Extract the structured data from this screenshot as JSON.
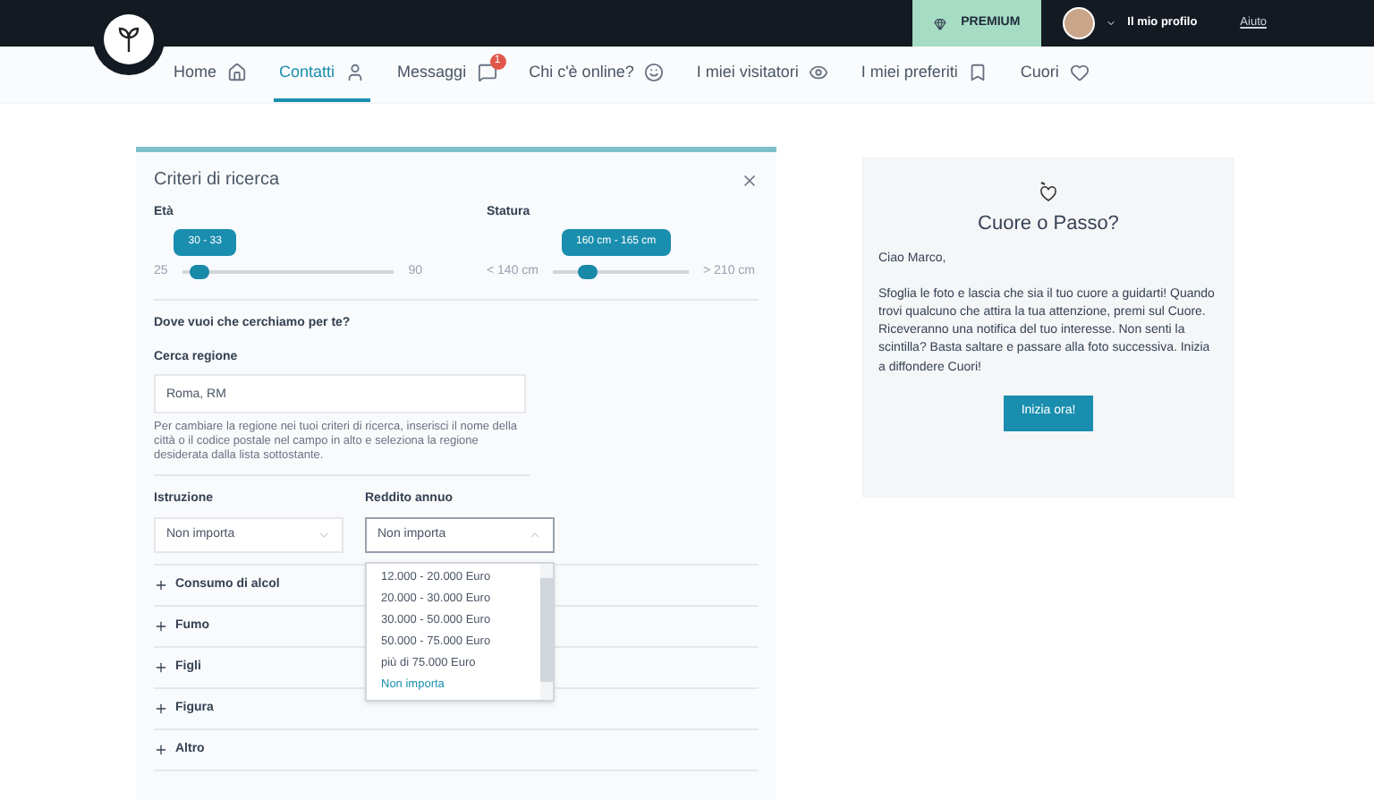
{
  "top_bar": {
    "premium": "PREMIUM",
    "profile": "Il mio profilo",
    "help": "Aiuto"
  },
  "nav": [
    {
      "label": "Home",
      "selected": false
    },
    {
      "label": "Contatti",
      "selected": true
    },
    {
      "label": "Messaggi",
      "selected": false,
      "badge": "1"
    },
    {
      "label": "Chi c'è online?",
      "selected": false
    },
    {
      "label": "I miei visitatori",
      "selected": false
    },
    {
      "label": "I miei preferiti",
      "selected": false
    },
    {
      "label": "Cuori",
      "selected": false
    }
  ],
  "search_panel": {
    "title": "Criteri di ricerca",
    "sliders": [
      {
        "label": "Età",
        "min": "25",
        "max": "90",
        "value": "30 - 33",
        "level": 0.08
      },
      {
        "label": "Statura",
        "min": "< 140 cm",
        "max": "> 210 cm",
        "value": "160 cm - 165 cm",
        "level": 0.25
      }
    ],
    "location_question": "Dove vuoi che cerchiamo per te?",
    "region": {
      "label": "Cerca regione",
      "value": "Roma, RM",
      "help": "Per cambiare la regione nei tuoi criteri di ricerca, inserisci il nome della città o il codice postale nel campo in alto e seleziona la regione desiderata dalla lista sottostante."
    },
    "selects": [
      {
        "label": "Istruzione",
        "value": "Non importa",
        "open": false
      },
      {
        "label": "Reddito annuo",
        "value": "Non importa",
        "open": true,
        "options": [
          {
            "label": "12.000 - 20.000 Euro",
            "selected": false
          },
          {
            "label": "20.000 - 30.000 Euro",
            "selected": false
          },
          {
            "label": "30.000 - 50.000 Euro",
            "selected": false
          },
          {
            "label": "50.000 - 75.000 Euro",
            "selected": false
          },
          {
            "label": "più di 75.000 Euro",
            "selected": false
          },
          {
            "label": "Non importa",
            "selected": true
          }
        ]
      }
    ],
    "sections": [
      {
        "label": "Consumo di alcol",
        "expanded": false
      },
      {
        "label": "Fumo",
        "expanded": false
      },
      {
        "label": "Figli",
        "expanded": false
      },
      {
        "label": "Figura",
        "expanded": false
      },
      {
        "label": "Altro",
        "expanded": false
      }
    ]
  },
  "promo_card": {
    "title": "Cuore o Passo?",
    "greeting": "Ciao Marco,",
    "body": "Sfoglia le foto e lascia che sia il tuo cuore a guidarti! Quando trovi qualcuno che attira la tua attenzione, premi sul Cuore. Riceveranno una notifica del tuo interesse. Non senti la scintilla? Basta saltare e passare alla foto successiva. Inizia a diffondere Cuori!",
    "button": "Inizia ora!"
  }
}
